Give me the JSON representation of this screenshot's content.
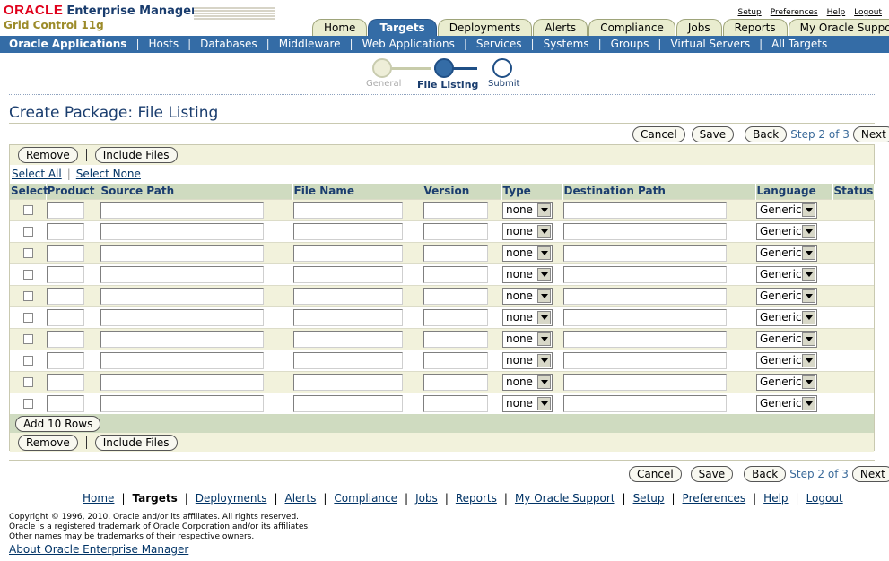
{
  "brand": {
    "oracle": "ORACLE",
    "product": "Enterprise Manager",
    "edition": "Grid Control 11g"
  },
  "global_links": [
    "Setup",
    "Preferences",
    "Help",
    "Logout"
  ],
  "tabs": [
    {
      "label": "Home",
      "active": false
    },
    {
      "label": "Targets",
      "active": true
    },
    {
      "label": "Deployments",
      "active": false
    },
    {
      "label": "Alerts",
      "active": false
    },
    {
      "label": "Compliance",
      "active": false
    },
    {
      "label": "Jobs",
      "active": false
    },
    {
      "label": "Reports",
      "active": false
    },
    {
      "label": "My Oracle Support",
      "active": false
    }
  ],
  "subnav": [
    {
      "label": "Oracle Applications",
      "active": true
    },
    {
      "label": "Hosts",
      "active": false
    },
    {
      "label": "Databases",
      "active": false
    },
    {
      "label": "Middleware",
      "active": false
    },
    {
      "label": "Web Applications",
      "active": false
    },
    {
      "label": "Services",
      "active": false
    },
    {
      "label": "Systems",
      "active": false
    },
    {
      "label": "Groups",
      "active": false
    },
    {
      "label": "Virtual Servers",
      "active": false
    },
    {
      "label": "All Targets",
      "active": false
    }
  ],
  "train": {
    "steps": [
      "General",
      "File Listing",
      "Submit"
    ],
    "current": 1
  },
  "page_title": "Create Package: File Listing",
  "nav_buttons": {
    "cancel": "Cancel",
    "save": "Save",
    "back": "Back",
    "step_text": "Step 2 of 3",
    "next": "Next"
  },
  "table_actions": {
    "remove": "Remove",
    "include_files": "Include Files",
    "select_all": "Select All",
    "select_none": "Select None",
    "add_rows": "Add 10 Rows"
  },
  "columns": [
    "Select",
    "Product",
    "Source Path",
    "File Name",
    "Version",
    "Type",
    "Destination Path",
    "Language",
    "Status"
  ],
  "rows": [
    {
      "type": "none",
      "language": "Generic"
    },
    {
      "type": "none",
      "language": "Generic"
    },
    {
      "type": "none",
      "language": "Generic"
    },
    {
      "type": "none",
      "language": "Generic"
    },
    {
      "type": "none",
      "language": "Generic"
    },
    {
      "type": "none",
      "language": "Generic"
    },
    {
      "type": "none",
      "language": "Generic"
    },
    {
      "type": "none",
      "language": "Generic"
    },
    {
      "type": "none",
      "language": "Generic"
    },
    {
      "type": "none",
      "language": "Generic"
    }
  ],
  "footer_links": [
    {
      "label": "Home",
      "active": false
    },
    {
      "label": "Targets",
      "active": true
    },
    {
      "label": "Deployments",
      "active": false
    },
    {
      "label": "Alerts",
      "active": false
    },
    {
      "label": "Compliance",
      "active": false
    },
    {
      "label": "Jobs",
      "active": false
    },
    {
      "label": "Reports",
      "active": false
    },
    {
      "label": "My Oracle Support",
      "active": false
    },
    {
      "label": "Setup",
      "active": false
    },
    {
      "label": "Preferences",
      "active": false
    },
    {
      "label": "Help",
      "active": false
    },
    {
      "label": "Logout",
      "active": false
    }
  ],
  "copyright": [
    "Copyright © 1996, 2010, Oracle and/or its affiliates. All rights reserved.",
    "Oracle is a registered trademark of Oracle Corporation and/or its affiliates.",
    "Other names may be trademarks of their respective owners."
  ],
  "about_link": "About Oracle Enterprise Manager"
}
